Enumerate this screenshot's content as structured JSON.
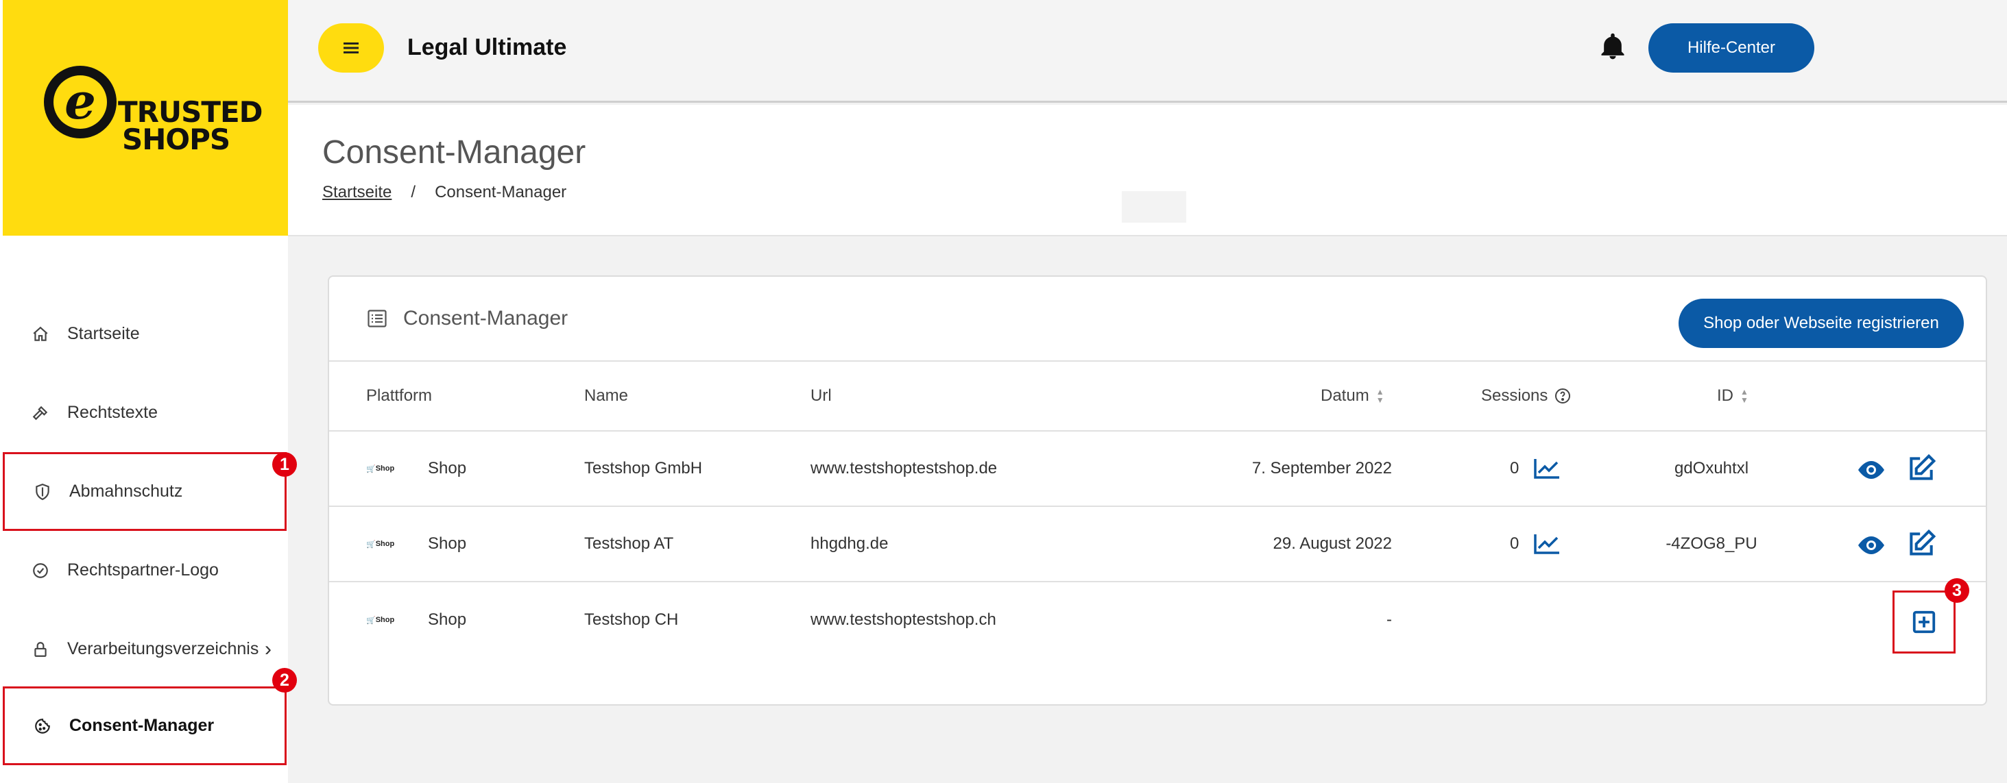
{
  "brand": {
    "logo_letter": "e",
    "logo_line1": "TRUSTED",
    "logo_line2": "SHOPS"
  },
  "header": {
    "app_title": "Legal Ultimate",
    "help_button": "Hilfe-Center"
  },
  "sidebar": {
    "items": [
      {
        "label": "Startseite",
        "icon": "home-icon"
      },
      {
        "label": "Rechtstexte",
        "icon": "gavel-icon"
      },
      {
        "label": "Abmahnschutz",
        "icon": "shield-icon",
        "badge": "1"
      },
      {
        "label": "Rechtspartner-Logo",
        "icon": "check-circle-icon"
      },
      {
        "label": "Verarbeitungsverzeichnis",
        "icon": "lock-icon",
        "chevron": "›"
      },
      {
        "label": "Consent-Manager",
        "icon": "cookie-icon",
        "badge": "2",
        "active": true
      }
    ]
  },
  "page": {
    "title": "Consent-Manager",
    "breadcrumb": {
      "home": "Startseite",
      "separator": "/",
      "current": "Consent-Manager"
    }
  },
  "card": {
    "title": "Consent-Manager",
    "register_button": "Shop oder Webseite registrieren",
    "columns": {
      "platform": "Plattform",
      "name": "Name",
      "url": "Url",
      "date": "Datum",
      "sessions": "Sessions",
      "id": "ID"
    },
    "rows": [
      {
        "platform_logo": "Shop",
        "platform": "Shop",
        "name": "Testshop GmbH",
        "url": "www.testshoptestshop.de",
        "date": "7. September 2022",
        "sessions": "0",
        "id": "gdOxuhtxl"
      },
      {
        "platform_logo": "Shop",
        "platform": "Shop",
        "name": "Testshop AT",
        "url": "hhgdhg.de",
        "date": "29. August 2022",
        "sessions": "0",
        "id": "-4ZOG8_PU"
      },
      {
        "platform_logo": "Shop",
        "platform": "Shop",
        "name": "Testshop CH",
        "url": "www.testshoptestshop.ch",
        "date": "-",
        "sessions": "",
        "id": ""
      }
    ],
    "add_badge": "3"
  },
  "colors": {
    "brand_yellow": "#ffdc0f",
    "primary_blue": "#0b5aa6",
    "highlight_red": "#d9111c"
  }
}
